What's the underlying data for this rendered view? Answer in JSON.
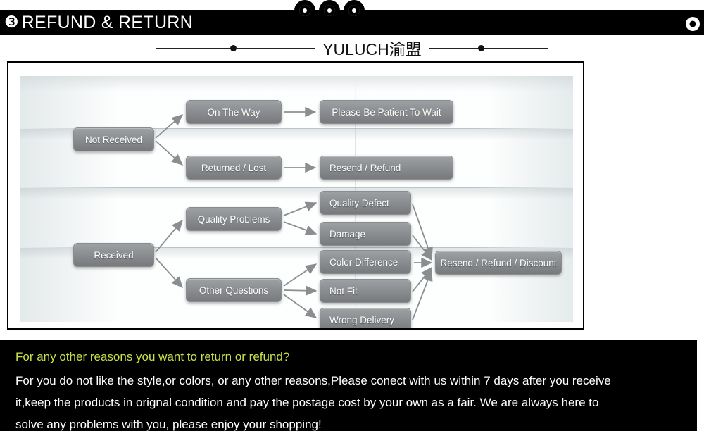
{
  "header": {
    "badge": "❸",
    "title": "REFUND & RETURN",
    "bubble_icon_1": "circle-dot-icon",
    "bubble_icon_2": "circle-dot-icon",
    "bubble_icon_3": "circle-dot-icon",
    "right_ring_icon": "circle-ring-icon"
  },
  "brand": {
    "name": "YULUCH渝盟",
    "left_dot_icon": "dot-icon",
    "right_dot_icon": "dot-icon"
  },
  "flow": {
    "nodes": {
      "not_received": "Not Received",
      "received": "Received",
      "on_the_way": "On The Way",
      "returned_lost": "Returned / Lost",
      "quality_problems": "Quality Problems",
      "other_questions": "Other Questions",
      "please_wait": "Please Be Patient To Wait",
      "resend_refund": "Resend / Refund",
      "quality_defect": "Quality Defect",
      "damage": "Damage",
      "color_difference": "Color Difference",
      "not_fit": "Not Fit",
      "wrong_delivery": "Wrong Delivery",
      "resend_refund_discount": "Resend / Refund / Discount"
    },
    "node_fill_top": "#9ea1a4",
    "node_fill_bottom": "#77797c",
    "node_text_color": "#ffffff",
    "arrow_color": "#8b8e91"
  },
  "footer": {
    "heading": "For any other reasons you want to return or refund?",
    "heading_color": "#c8e04a",
    "line1": "For you do not like the style,or colors, or any other reasons,Please conect with us within 7 days after you receive",
    "line2": "it,keep the products in orignal condition and pay the postage cost by your own as a fair. We are always here to",
    "line3": "solve any problems with you, please enjoy your shopping!",
    "text_color": "#ffffff",
    "background_color": "#000000"
  }
}
